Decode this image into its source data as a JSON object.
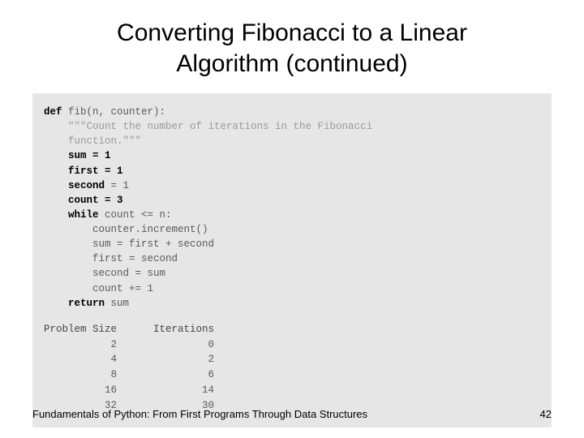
{
  "title_line1": "Converting Fibonacci to a Linear",
  "title_line2": "Algorithm (continued)",
  "code": {
    "def": "def",
    "sig": " fib(n, counter):",
    "doc1": "    \"\"\"Count the number of iterations in the Fibonacci",
    "doc2": "    function.\"\"\"",
    "l_sum": "    sum = 1",
    "l_first": "    first = 1",
    "l_second_kw": "    second",
    "l_second_rest": " = 1",
    "l_count": "    count = 3",
    "l_while_kw": "    while",
    "l_while_rest": " count <= n:",
    "l_incr": "        counter.increment()",
    "l_sumcalc": "        sum = first + second",
    "l_firsteq": "        first = second",
    "l_secondeq": "        second = sum",
    "l_countinc": "        count += 1",
    "l_return_kw": "    return",
    "l_return_rest": " sum"
  },
  "table": {
    "header": "Problem Size      Iterations",
    "rows": [
      "           2               0",
      "           4               2",
      "           8               6",
      "          16              14",
      "          32              30"
    ]
  },
  "footer": "Fundamentals of Python: From First Programs Through Data Structures",
  "page": "42"
}
